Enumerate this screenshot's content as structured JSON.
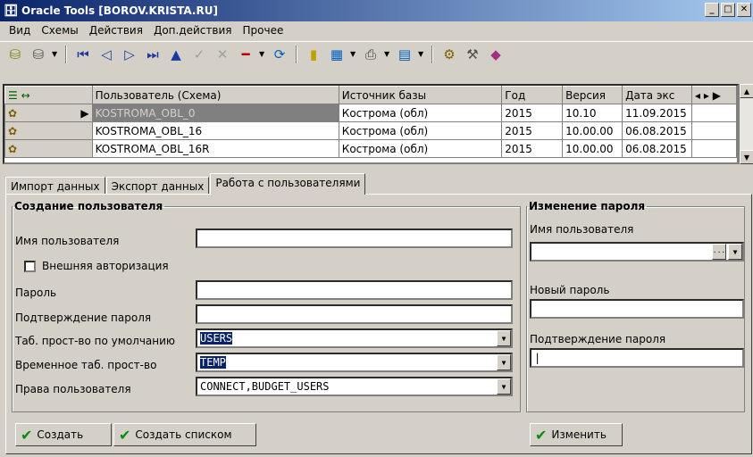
{
  "window": {
    "title": "Oracle Tools [BOROV.KRISTA.RU]",
    "app_icon": "database-icon"
  },
  "menu": [
    "Вид",
    "Схемы",
    "Действия",
    "Доп.действия",
    "Прочее"
  ],
  "toolbar": {
    "nav": [
      "first-icon",
      "prev-icon",
      "next-icon",
      "last-icon",
      "up-icon",
      "check-icon",
      "cancel-icon",
      "minus-icon",
      "refresh-icon"
    ]
  },
  "grid": {
    "headers": [
      "Пользователь (Схема)",
      "Источник базы",
      "Год",
      "Версия",
      "Дата экс"
    ],
    "rows": [
      [
        "KOSTROMA_OBL_0",
        "Кострома (обл)",
        "2015",
        "10.10",
        "11.09.2015"
      ],
      [
        "KOSTROMA_OBL_16",
        "Кострома (обл)",
        "2015",
        "10.00.00",
        "06.08.2015"
      ],
      [
        "KOSTROMA_OBL_16R",
        "Кострома (обл)",
        "2015",
        "10.00.00",
        "06.08.2015"
      ]
    ]
  },
  "tabs": [
    "Импорт данных",
    "Экспорт данных",
    "Работа с пользователями"
  ],
  "create_user": {
    "legend": "Создание пользователя",
    "username_label": "Имя пользователя",
    "username_value": "",
    "external_auth_label": "Внешняя авторизация",
    "password_label": "Пароль",
    "password_confirm_label": "Подтверждение пароля",
    "default_ts_label": "Таб. прост-во по умолчанию",
    "default_ts_value": "USERS",
    "temp_ts_label": "Временное таб. прост-во",
    "temp_ts_value": "TEMP",
    "rights_label": "Права пользователя",
    "rights_value": "CONNECT,BUDGET_USERS",
    "create_button": "Создать",
    "create_list_button": "Создать списком"
  },
  "change_password": {
    "legend": "Изменение пароля",
    "username_label": "Имя пользователя",
    "new_password_label": "Новый пароль",
    "confirm_label": "Подтверждение пароля",
    "change_button": "Изменить"
  }
}
